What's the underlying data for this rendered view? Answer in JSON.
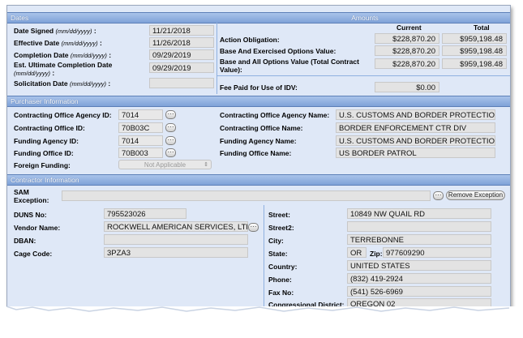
{
  "sections": {
    "dates": "Dates",
    "amounts": "Amounts",
    "purchaser": "Purchaser Information",
    "contractor": "Contractor Information"
  },
  "dates": {
    "signed": {
      "label": "Date Signed",
      "hint": "(mm/dd/yyyy)",
      "value": "11/21/2018"
    },
    "effective": {
      "label": "Effective Date",
      "hint": "(mm/dd/yyyy)",
      "value": "11/26/2018"
    },
    "completion": {
      "label": "Completion Date",
      "hint": "(mm/dd/yyyy)",
      "value": "09/29/2019"
    },
    "ultimate": {
      "label": "Est. Ultimate Completion Date",
      "hint": "(mm/dd/yyyy)",
      "value": "09/29/2019"
    },
    "solicitation": {
      "label": "Solicitation Date",
      "hint": "(mm/dd/yyyy)",
      "value": ""
    }
  },
  "amounts": {
    "col_current": "Current",
    "col_total": "Total",
    "action_obligation": {
      "label": "Action Obligation:",
      "current": "$228,870.20",
      "total": "$959,198.48"
    },
    "base_exercised": {
      "label": "Base And Exercised Options Value:",
      "current": "$228,870.20",
      "total": "$959,198.48"
    },
    "base_all": {
      "label": "Base and All Options Value (Total Contract Value):",
      "current": "$228,870.20",
      "total": "$959,198.48"
    },
    "fee_paid": {
      "label": "Fee Paid for Use of IDV:",
      "value": "$0.00"
    }
  },
  "purchaser": {
    "contracting_agency_id": {
      "label": "Contracting Office Agency ID:",
      "value": "7014"
    },
    "contracting_office_id": {
      "label": "Contracting Office ID:",
      "value": "70B03C"
    },
    "funding_agency_id": {
      "label": "Funding Agency ID:",
      "value": "7014"
    },
    "funding_office_id": {
      "label": "Funding Office ID:",
      "value": "70B003"
    },
    "foreign_funding": {
      "label": "Foreign Funding:",
      "value": "Not Applicable"
    },
    "contracting_agency_name": {
      "label": "Contracting Office Agency Name:",
      "value": "U.S. CUSTOMS AND BORDER PROTECTION"
    },
    "contracting_office_name": {
      "label": "Contracting Office Name:",
      "value": "BORDER ENFORCEMENT CTR DIV"
    },
    "funding_agency_name": {
      "label": "Funding Agency Name:",
      "value": "U.S. CUSTOMS AND BORDER PROTECTION"
    },
    "funding_office_name": {
      "label": "Funding Office Name:",
      "value": "US BORDER PATROL"
    }
  },
  "contractor": {
    "sam_label_1": "SAM",
    "sam_label_2": "Exception:",
    "sam_value": "",
    "remove_exception": "Remove Exception",
    "duns": {
      "label": "DUNS No:",
      "value": "795523026"
    },
    "vendor": {
      "label": "Vendor Name:",
      "value": "ROCKWELL AMERICAN SERVICES, LTD."
    },
    "dban": {
      "label": "DBAN:",
      "value": ""
    },
    "cage": {
      "label": "Cage Code:",
      "value": "3PZA3"
    },
    "street": {
      "label": "Street:",
      "value": "10849 NW QUAIL RD"
    },
    "street2": {
      "label": "Street2:",
      "value": ""
    },
    "city": {
      "label": "City:",
      "value": "TERREBONNE"
    },
    "state": {
      "label": "State:",
      "value": "OR"
    },
    "zip": {
      "label": "Zip:",
      "value": "977609290"
    },
    "country": {
      "label": "Country:",
      "value": "UNITED STATES"
    },
    "phone": {
      "label": "Phone:",
      "value": "(832) 419-2924"
    },
    "fax": {
      "label": "Fax No:",
      "value": "(541) 526-6969"
    },
    "district": {
      "label": "Congressional District:",
      "value": "OREGON 02"
    }
  },
  "icons": {
    "lookup": "ellipsis-lookup-icon",
    "dropdown": "updown-arrow-icon"
  },
  "colors": {
    "section_bar": "#7fa2d8",
    "panel": "#dfe8f7",
    "field": "#e3e3e3"
  }
}
